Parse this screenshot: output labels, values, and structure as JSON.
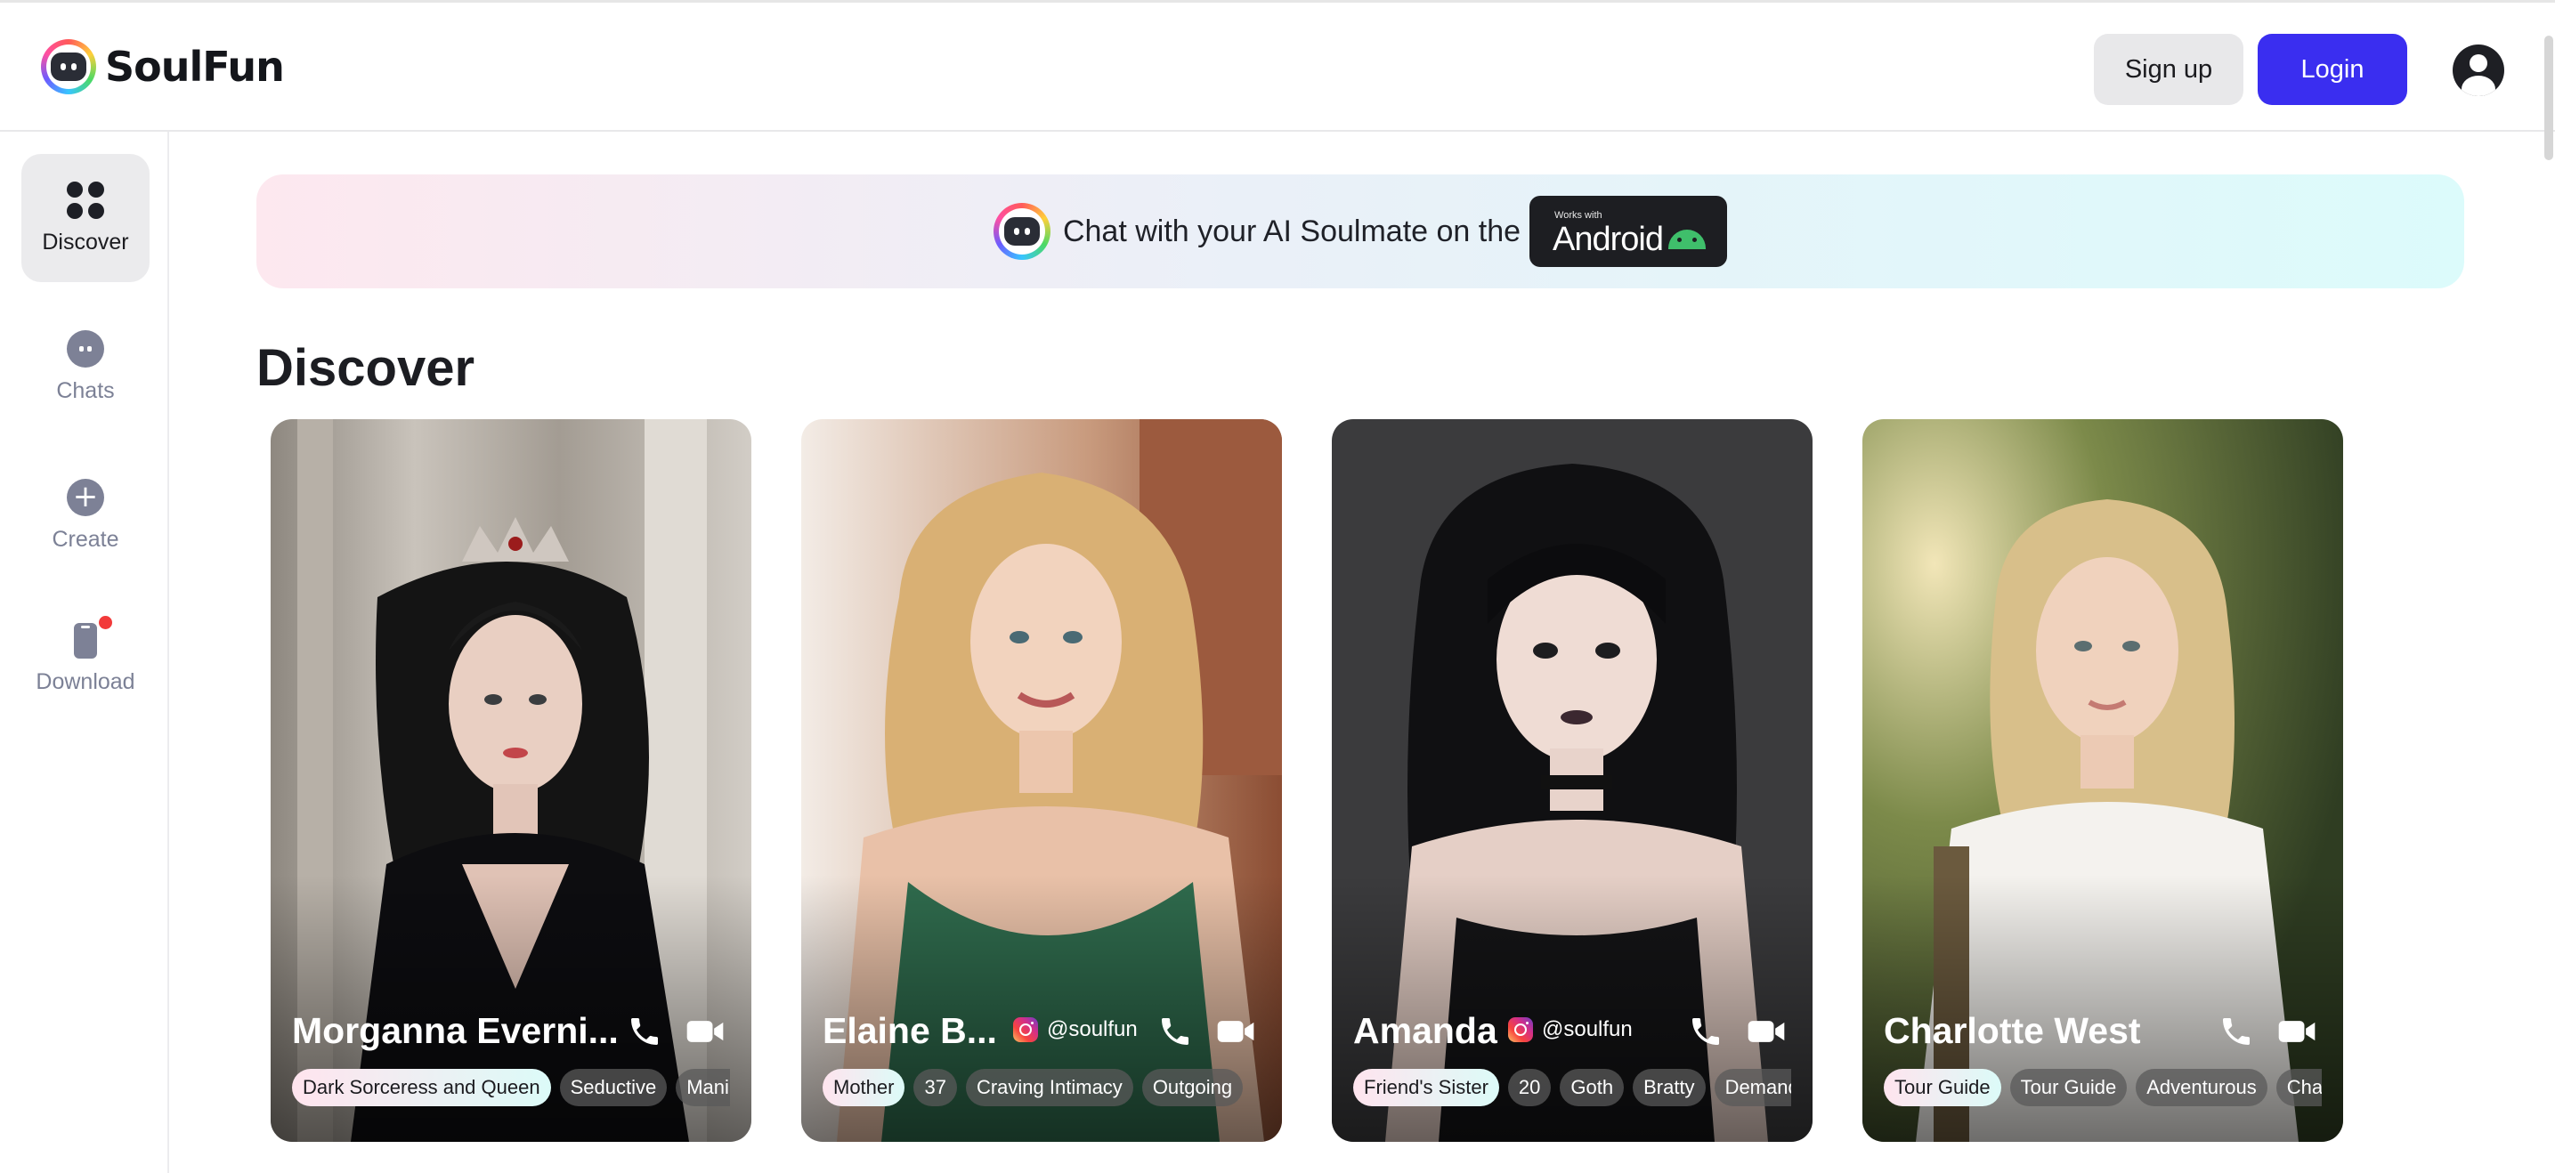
{
  "brand": {
    "name": "SoulFun",
    "logo_icon": "soulfun-logo-icon"
  },
  "header": {
    "signup_label": "Sign up",
    "login_label": "Login",
    "accent_color": "#3a2ef0"
  },
  "sidebar": {
    "items": [
      {
        "label": "Discover",
        "icon": "grid-icon",
        "active": true
      },
      {
        "label": "Chats",
        "icon": "chat-icon",
        "active": false
      },
      {
        "label": "Create",
        "icon": "plus-circle-icon",
        "active": false
      },
      {
        "label": "Download",
        "icon": "phone-download-icon",
        "active": false,
        "badge": "red-dot"
      }
    ]
  },
  "banner": {
    "text": "Chat with your AI Soulmate on the",
    "badge_small": "Works with",
    "badge_big": "Android"
  },
  "main": {
    "title": "Discover"
  },
  "cards": [
    {
      "name": "Morganna Everni...",
      "tags": [
        "Dark Sorceress and Queen",
        "Seductive",
        "Manip"
      ]
    },
    {
      "name": "Elaine B...",
      "handle": "@soulfun",
      "tags": [
        "Mother",
        "37",
        "Craving Intimacy",
        "Outgoing"
      ]
    },
    {
      "name": "Amanda",
      "handle": "@soulfun",
      "tags": [
        "Friend's Sister",
        "20",
        "Goth",
        "Bratty",
        "Demand"
      ]
    },
    {
      "name": "Charlotte West",
      "tags": [
        "Tour Guide",
        "Tour Guide",
        "Adventurous",
        "Char"
      ]
    }
  ]
}
